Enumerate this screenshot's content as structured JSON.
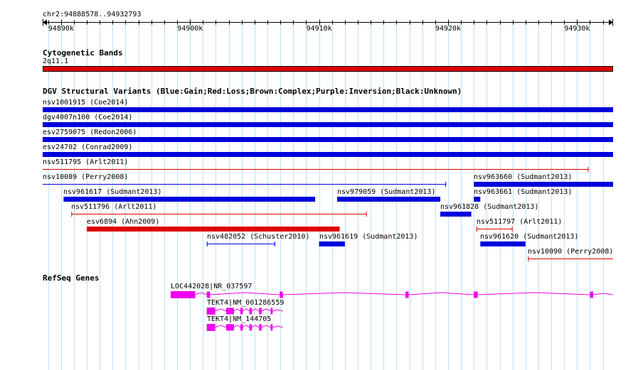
{
  "ruler": {
    "range_label": "chr2:94888578..94932793",
    "start": 94888578,
    "end": 94932793,
    "ticks": [
      {
        "pos": 94890000,
        "label": "94890k"
      },
      {
        "pos": 94900000,
        "label": "94900k"
      },
      {
        "pos": 94910000,
        "label": "94910k"
      },
      {
        "pos": 94920000,
        "label": "94920k"
      },
      {
        "pos": 94930000,
        "label": "94930k"
      }
    ]
  },
  "cytoband": {
    "title": "Cytogenetic Bands",
    "band_label": "2q11.1",
    "color": "#e00000"
  },
  "dgv": {
    "title": "DGV Structural Variants (Blue:Gain;Red:Loss;Brown:Complex;Purple:Inversion;Black:Unknown)",
    "colors": {
      "gain": "#0000dd",
      "loss": "#dd0000"
    },
    "features": [
      {
        "label": "nsv1001915 (Coe2014)",
        "type": "gain",
        "style": "thick",
        "start": 94888578,
        "end": 94932793,
        "row": 0
      },
      {
        "label": "dgv4007n100 (Coe2014)",
        "type": "gain",
        "style": "thick",
        "start": 94888578,
        "end": 94932793,
        "row": 1
      },
      {
        "label": "esv2759075 (Redon2006)",
        "type": "gain",
        "style": "thick",
        "start": 94888578,
        "end": 94932793,
        "row": 2
      },
      {
        "label": "esv24702 (Conrad2009)",
        "type": "gain",
        "style": "thick",
        "start": 94888578,
        "end": 94932793,
        "row": 3
      },
      {
        "label": "nsv511795 (Arlt2011)",
        "type": "loss",
        "style": "thin",
        "start": 94888578,
        "end": 94930900,
        "row": 4
      },
      {
        "label": "nsv10089 (Perry2008)",
        "type": "gain",
        "style": "thin",
        "start": 94888578,
        "end": 94919850,
        "row": 5
      },
      {
        "label": "nsv963660 (Sudmant2013)",
        "type": "gain",
        "style": "thick",
        "start": 94922000,
        "end": 94932793,
        "row": 5
      },
      {
        "label": "nsv961617 (Sudmant2013)",
        "type": "gain",
        "style": "thick",
        "start": 94890200,
        "end": 94909700,
        "row": 6
      },
      {
        "label": "nsv979059 (Sudmant2013)",
        "type": "gain",
        "style": "thick",
        "start": 94911400,
        "end": 94919400,
        "row": 6
      },
      {
        "label": "nsv963661 (Sudmant2013)",
        "type": "gain",
        "style": "thick",
        "start": 94922000,
        "end": 94922500,
        "row": 6
      },
      {
        "label": "nsv511796 (Arlt2011)",
        "type": "loss",
        "style": "thin",
        "start": 94890800,
        "end": 94913700,
        "row": 7
      },
      {
        "label": "nsv961828 (Sudmant2013)",
        "type": "gain",
        "style": "thick",
        "start": 94919400,
        "end": 94921800,
        "row": 7
      },
      {
        "label": "esv6894 (Ahn2009)",
        "type": "loss",
        "style": "thick",
        "start": 94892000,
        "end": 94911600,
        "row": 8
      },
      {
        "label": "nsv511797 (Arlt2011)",
        "type": "loss",
        "style": "thin",
        "start": 94922200,
        "end": 94925000,
        "row": 8
      },
      {
        "label": "nsv482052 (Schuster2010)",
        "type": "gain",
        "style": "thin",
        "start": 94901300,
        "end": 94906600,
        "row": 9
      },
      {
        "label": "nsv961619 (Sudmant2013)",
        "type": "gain",
        "style": "thick",
        "start": 94910000,
        "end": 94912000,
        "row": 9
      },
      {
        "label": "nsv961620 (Sudmant2013)",
        "type": "gain",
        "style": "thick",
        "start": 94922500,
        "end": 94926000,
        "row": 9
      },
      {
        "label": "nsv10090 (Perry2008)",
        "type": "loss",
        "style": "thin",
        "start": 94926200,
        "end": 94932793,
        "row": 10
      }
    ]
  },
  "refseq": {
    "title": "RefSeq Genes",
    "color": "#ee00ee",
    "genes": [
      {
        "label": "LOC442028|NR_037597",
        "start": 94898500,
        "end": 94932793,
        "row": 0,
        "exons": [
          [
            94898500,
            94900400
          ],
          [
            94901300,
            94901550
          ],
          [
            94906950,
            94907200
          ],
          [
            94916700,
            94916950
          ],
          [
            94922000,
            94922300
          ],
          [
            94931000,
            94931250
          ]
        ]
      },
      {
        "label": "TEKT4|NM_001286559",
        "start": 94901300,
        "end": 94907200,
        "row": 1,
        "exons": [
          [
            94901300,
            94901950
          ],
          [
            94902800,
            94903400
          ],
          [
            94903900,
            94904100
          ],
          [
            94904600,
            94904800
          ],
          [
            94905350,
            94905550
          ],
          [
            94906250,
            94906400
          ]
        ]
      },
      {
        "label": "TEKT4|NM_144705",
        "start": 94901300,
        "end": 94907200,
        "row": 2,
        "exons": [
          [
            94901300,
            94901950
          ],
          [
            94902800,
            94903400
          ],
          [
            94903900,
            94904100
          ],
          [
            94904600,
            94904800
          ],
          [
            94905350,
            94905550
          ],
          [
            94906250,
            94906400
          ]
        ]
      }
    ]
  }
}
